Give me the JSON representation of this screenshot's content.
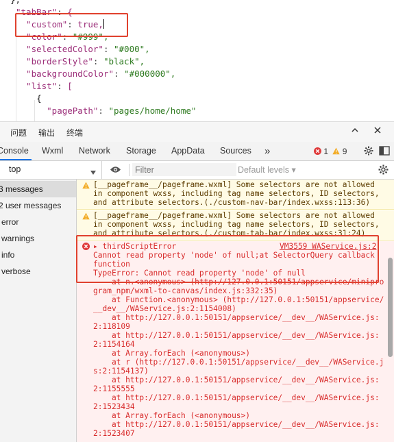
{
  "editor": {
    "lines": [
      "},",
      "\"tabBar\": {",
      "  \"custom\": true,",
      "  \"color\": \"#999\",",
      "  \"selectedColor\": \"#000\",",
      "  \"borderStyle\": \"black\",",
      "  \"backgroundColor\": \"#000000\",",
      "  \"list\": [",
      "    {",
      "      \"pagePath\": \"pages/home/home\""
    ]
  },
  "panel": {
    "tabs": [
      "问题",
      "输出",
      "终端"
    ],
    "icons": [
      "chevron-up-icon",
      "close-icon"
    ]
  },
  "devtools": {
    "tabs": [
      "Console",
      "Wxml",
      "Network",
      "Storage",
      "AppData",
      "Sources",
      "»"
    ],
    "active_tab": "Console",
    "error_count": "1",
    "warning_count": "9"
  },
  "filter": {
    "context": "top",
    "placeholder": "Filter",
    "levels": "Default levels ▾"
  },
  "sidebar": {
    "items": [
      "3 messages",
      "2 user messages",
      "error",
      "warnings",
      "info",
      "verbose"
    ]
  },
  "console": {
    "messages": [
      {
        "level": "warning",
        "lines": [
          "[__pageframe__/pageframe.wxml] Some selectors are not allowed",
          "in component wxss, including tag name selectors, ID selectors,",
          "and attribute selectors.(./custom-nav-bar/index.wxss:113:36)"
        ]
      },
      {
        "level": "warning",
        "lines": [
          "[__pageframe__/pageframe.wxml] Some selectors are not allowed",
          "in component wxss, including tag name selectors, ID selectors,",
          "and attribute selectors.(./custom-tab-bar/index.wxss:31:24)"
        ]
      },
      {
        "level": "error",
        "source": "VM3559 WAService.js:2",
        "title": "▸ thirdScriptError",
        "lines": [
          "Cannot read property 'node' of null;at SelectorQuery callback",
          "function",
          "TypeError: Cannot read property 'node' of null",
          "    at n.<anonymous> (http://127.0.0.1:50151/appservice/minipro",
          "gram_npm/wxml-to-canvas/index.js:332:35)",
          "    at Function.<anonymous> (http://127.0.0.1:50151/appservice/",
          "__dev__/WAService.js:2:1154008)",
          "    at http://127.0.0.1:50151/appservice/__dev__/WAService.js:",
          "2:118109",
          "    at http://127.0.0.1:50151/appservice/__dev__/WAService.js:",
          "2:1154164",
          "    at Array.forEach (<anonymous>)",
          "    at r (http://127.0.0.1:50151/appservice/__dev__/WAService.j",
          "s:2:1154137)",
          "    at http://127.0.0.1:50151/appservice/__dev__/WAService.js:",
          "2:1155555",
          "    at http://127.0.0.1:50151/appservice/__dev__/WAService.js:",
          "2:1523434",
          "    at Array.forEach (<anonymous>)",
          "    at http://127.0.0.1:50151/appservice/__dev__/WAService.js:",
          "2:1523407"
        ]
      }
    ]
  },
  "colors": {
    "highlight_box": "#e0412e",
    "error_text": "#d82b2b",
    "warning_bg": "#fffbe5",
    "error_bg": "#fff0f0"
  }
}
